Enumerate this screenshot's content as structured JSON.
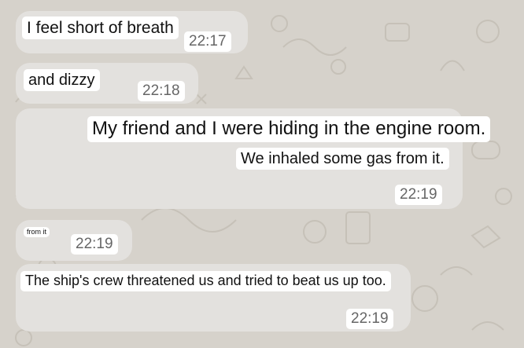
{
  "messages": [
    {
      "text": "I feel short of breath",
      "time": "22:17"
    },
    {
      "text": "and dizzy",
      "time": "22:18"
    },
    {
      "lines": [
        "My friend and I were hiding in the engine room.",
        "We inhaled some gas from it."
      ],
      "time": "22:19"
    },
    {
      "text": "from it",
      "time": "22:19"
    },
    {
      "text": "The ship's crew threatened us and tried to beat us up too.",
      "time": "22:19"
    }
  ],
  "colors": {
    "wallpaper": "#d6d2cb",
    "bubble": "#e3e1de",
    "text_highlight": "#ffffff",
    "doodle": "#c6c1b8"
  }
}
